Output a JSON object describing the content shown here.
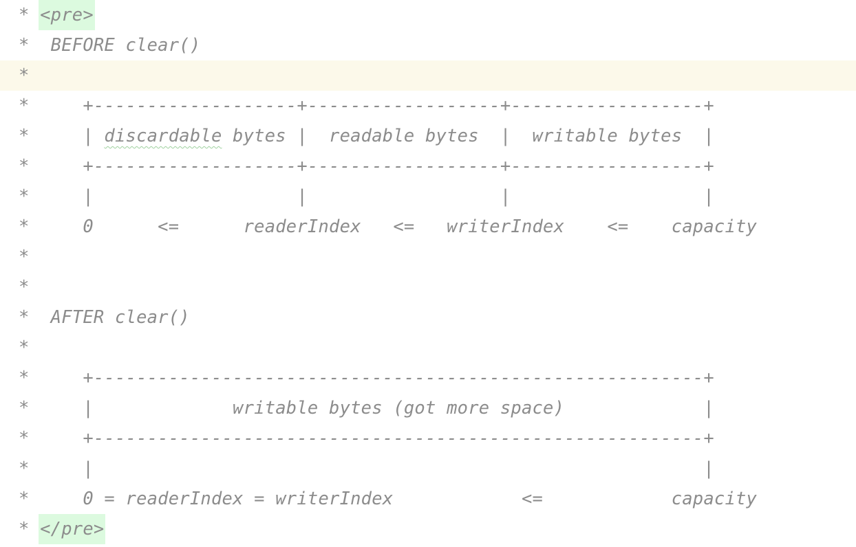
{
  "editor": {
    "lines": [
      {
        "prefix": "* ",
        "tag": "<pre>"
      },
      {
        "text": "*  BEFORE clear()"
      },
      {
        "text": "*"
      },
      {
        "text": "*     +-------------------+------------------+------------------+"
      },
      {
        "prefix": "*     | ",
        "typo": "discardable",
        "suffix": " bytes |  readable bytes  |  writable bytes  |"
      },
      {
        "text": "*     +-------------------+------------------+------------------+"
      },
      {
        "text": "*     |                   |                  |                  |"
      },
      {
        "text": "*     0      <=      readerIndex   <=   writerIndex    <=    capacity"
      },
      {
        "text": "*"
      },
      {
        "text": "*"
      },
      {
        "text": "*  AFTER clear()"
      },
      {
        "text": "*"
      },
      {
        "text": "*     +---------------------------------------------------------+"
      },
      {
        "text": "*     |             writable bytes (got more space)             |"
      },
      {
        "text": "*     +---------------------------------------------------------+"
      },
      {
        "text": "*     |                                                         |"
      },
      {
        "text": "*     0 = readerIndex = writerIndex            <=            capacity"
      },
      {
        "prefix": "* ",
        "tag": "</pre>"
      }
    ],
    "current_line": 3
  },
  "colors": {
    "comment": "#8c8c8c",
    "current_line_bg": "#fcf9ea",
    "tag_bg": "#dcfadf"
  }
}
